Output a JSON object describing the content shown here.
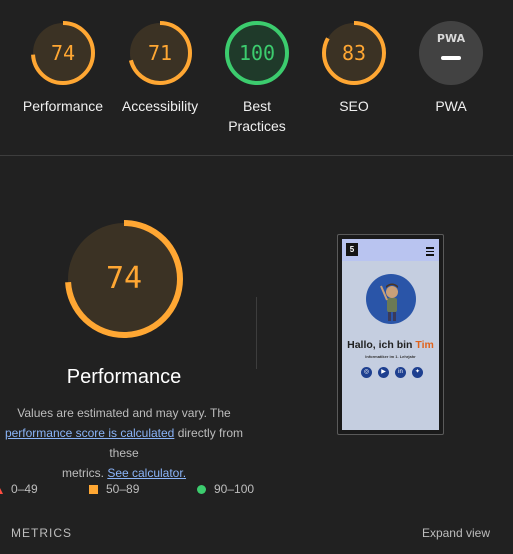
{
  "gauges": [
    {
      "score": "74",
      "label": "Performance",
      "color": "#ffa733"
    },
    {
      "score": "71",
      "label": "Accessibility",
      "color": "#ffa733"
    },
    {
      "score": "100",
      "label": "Best Practices",
      "color": "#3ccc6e"
    },
    {
      "score": "83",
      "label": "SEO",
      "color": "#ffa733"
    },
    {
      "label": "PWA",
      "badge": "PWA"
    }
  ],
  "main": {
    "score": "74",
    "title": "Performance",
    "desc_line1": "Values are estimated and may vary. The",
    "desc_link": "performance score is calculated",
    "desc_mid": " directly from these",
    "desc_line3_pre": "metrics. ",
    "desc_link2": "See calculator.",
    "score_fraction": 0.74
  },
  "legend": [
    {
      "range": "0–49",
      "color": "#ff4e42"
    },
    {
      "range": "50–89",
      "color": "#ffa733"
    },
    {
      "range": "90–100",
      "color": "#3ccc6e"
    }
  ],
  "footer": {
    "metrics_label": "METRICS",
    "expand_label": "Expand view"
  },
  "preview": {
    "html5_badge": "5",
    "hero_prefix": "Hallo, ich bin ",
    "hero_name": "Tim",
    "subtitle": "Informatiker im 1. Lehrjahr",
    "social_icons": [
      "instagram-icon",
      "youtube-icon",
      "linkedin-icon",
      "twitter-icon"
    ]
  }
}
